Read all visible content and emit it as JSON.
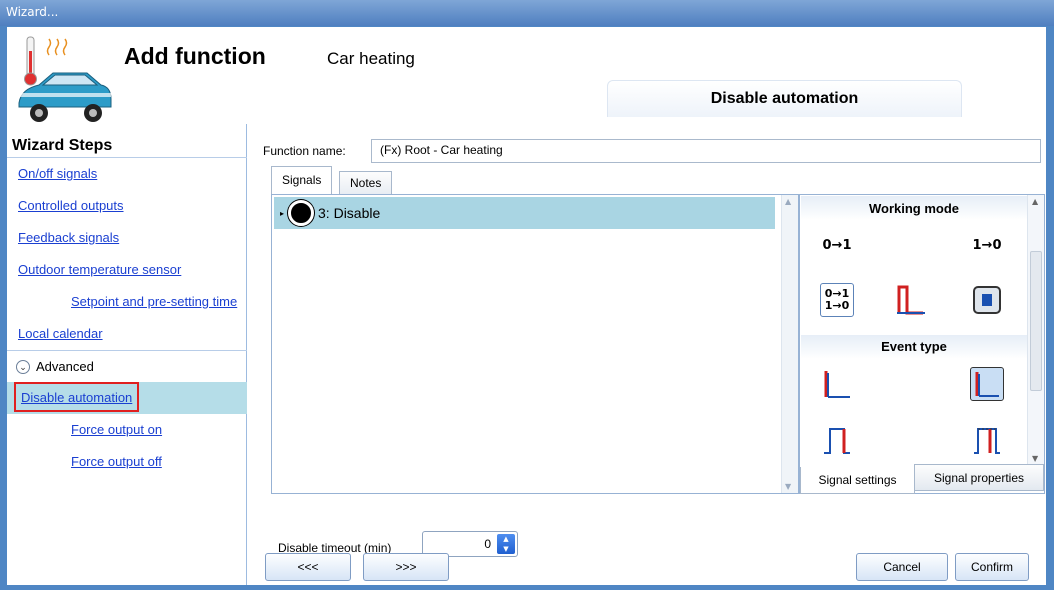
{
  "window": {
    "title": "Wizard..."
  },
  "header": {
    "title": "Add function",
    "subtitle": "Car heating",
    "section_tab": "Disable automation",
    "icon": "car-heating-icon"
  },
  "wizard_steps": {
    "title": "Wizard Steps",
    "items": [
      {
        "label": "On/off signals"
      },
      {
        "label": "Controlled outputs"
      },
      {
        "label": "Feedback signals"
      },
      {
        "label": "Outdoor temperature sensor"
      },
      {
        "label": "Setpoint and pre-setting time"
      },
      {
        "label": "Local calendar"
      }
    ],
    "advanced_label": "Advanced",
    "advanced_items": [
      {
        "label": "Disable automation"
      },
      {
        "label": "Force output on"
      },
      {
        "label": "Force output off"
      }
    ],
    "selected": "Disable automation"
  },
  "function_name": {
    "label": "Function name:",
    "value": "(Fx) Root - Car heating"
  },
  "tabs": [
    {
      "label": "Signals"
    },
    {
      "label": "Notes"
    }
  ],
  "signals": [
    {
      "label": "3: Disable"
    }
  ],
  "right_panel": {
    "working_mode_title": "Working mode",
    "working_mode_icons": [
      "0→1",
      "1→0"
    ],
    "event_type_title": "Event type",
    "tabs": [
      {
        "label": "Signal settings"
      },
      {
        "label": "Signal properties"
      }
    ]
  },
  "timeout": {
    "label": "Disable timeout (min)",
    "value": "0"
  },
  "buttons": {
    "prev": "<<<",
    "next": ">>>",
    "cancel": "Cancel",
    "confirm": "Confirm"
  },
  "colors": {
    "selected_row": "#a9d5e3",
    "link": "#1a3fd1",
    "highlight_border": "#e02020",
    "titlebar": "#4f86c4"
  }
}
